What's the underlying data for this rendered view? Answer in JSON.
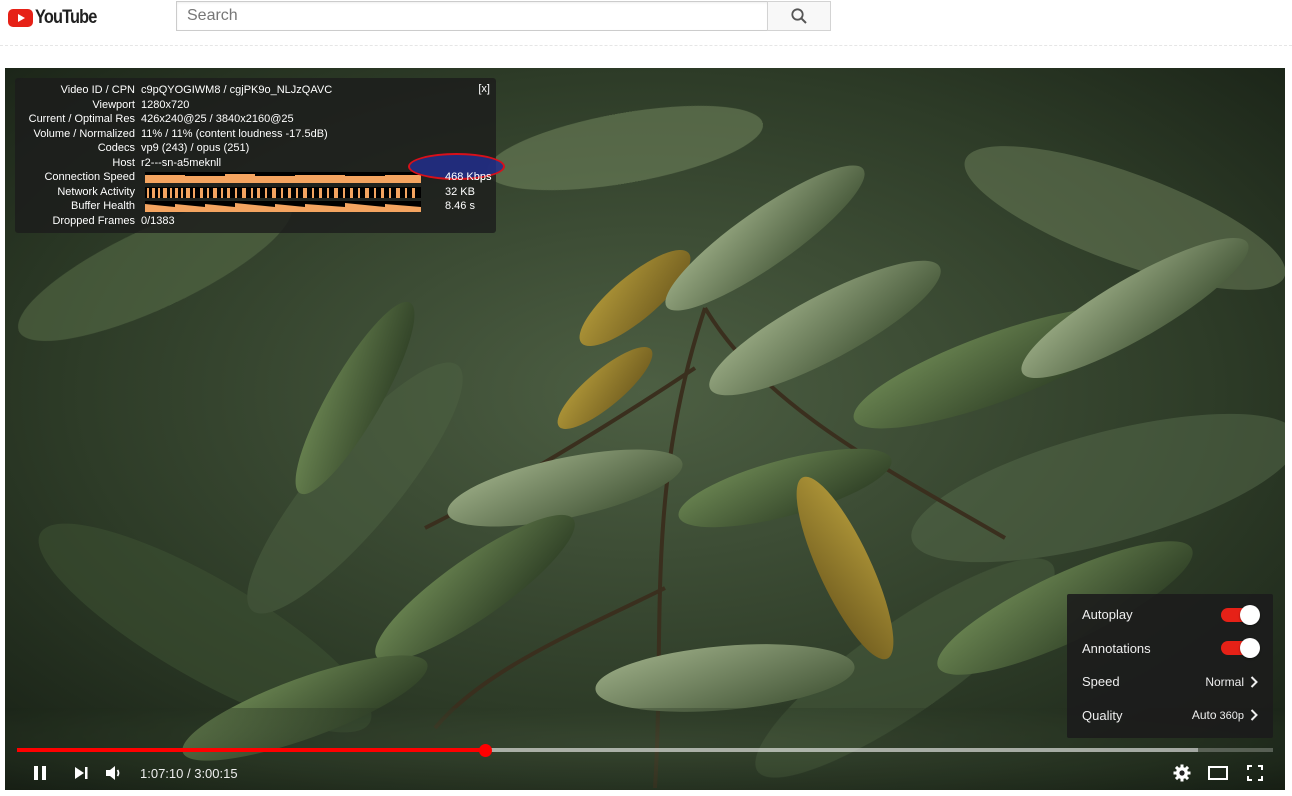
{
  "header": {
    "logo_text": "YouTube",
    "search_placeholder": "Search"
  },
  "stats": {
    "close_label": "[x]",
    "rows": [
      {
        "label": "Video ID / CPN",
        "value": "c9pQYOGIWM8 / cgjPK9o_NLJzQAVC"
      },
      {
        "label": "Viewport",
        "value": "1280x720"
      },
      {
        "label": "Current / Optimal Res",
        "value": "426x240@25 / 3840x2160@25"
      },
      {
        "label": "Volume / Normalized",
        "value": "11% / 11% (content loudness -17.5dB)"
      },
      {
        "label": "Codecs",
        "value": "vp9 (243) / opus (251)"
      },
      {
        "label": "Host",
        "value": "r2---sn-a5meknll"
      }
    ],
    "graphs": [
      {
        "label": "Connection Speed",
        "readout": "468 Kbps"
      },
      {
        "label": "Network Activity",
        "readout": "32 KB"
      },
      {
        "label": "Buffer Health",
        "readout": "8.46 s"
      }
    ],
    "dropped_frames": {
      "label": "Dropped Frames",
      "value": "0/1383"
    }
  },
  "settings": {
    "autoplay_label": "Autoplay",
    "annotations_label": "Annotations",
    "speed_label": "Speed",
    "speed_value": "Normal",
    "quality_label": "Quality",
    "quality_value": "Auto",
    "quality_sub": "360p"
  },
  "player": {
    "time_display": "1:07:10 / 3:00:15",
    "progress_fraction": 0.373,
    "buffer_fraction": 0.94
  },
  "colors": {
    "brand_red": "#e62117",
    "graph_orange": "#f4a460",
    "annotation_circle": "#d8101a"
  },
  "icons": [
    "youtube-logo-icon",
    "search-icon",
    "pause-icon",
    "next-icon",
    "volume-icon",
    "gear-icon",
    "theater-mode-icon",
    "fullscreen-icon",
    "chevron-right-icon"
  ]
}
